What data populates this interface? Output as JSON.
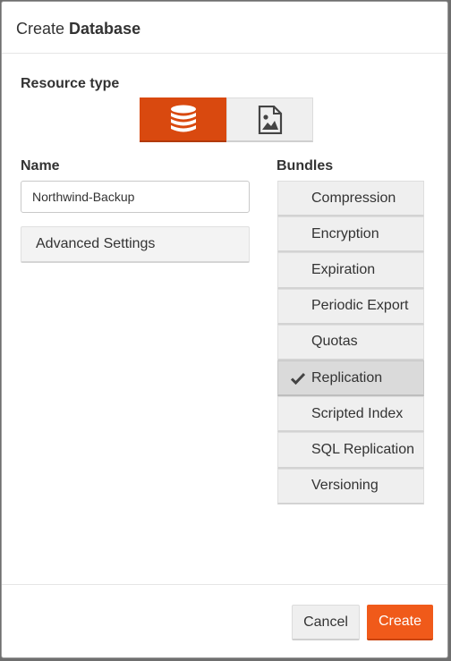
{
  "dialog": {
    "title_prefix": "Create",
    "title_bold": "Database"
  },
  "resource_type": {
    "label": "Resource type",
    "options": [
      {
        "icon": "database-icon",
        "selected": true
      },
      {
        "icon": "image-icon",
        "selected": false
      }
    ]
  },
  "name": {
    "label": "Name",
    "value": "Northwind-Backup"
  },
  "advanced_settings_label": "Advanced Settings",
  "bundles": {
    "label": "Bundles",
    "items": [
      {
        "label": "Compression",
        "selected": false
      },
      {
        "label": "Encryption",
        "selected": false
      },
      {
        "label": "Expiration",
        "selected": false
      },
      {
        "label": "Periodic Export",
        "selected": false
      },
      {
        "label": "Quotas",
        "selected": false
      },
      {
        "label": "Replication",
        "selected": true
      },
      {
        "label": "Scripted Index",
        "selected": false
      },
      {
        "label": "SQL Replication",
        "selected": false
      },
      {
        "label": "Versioning",
        "selected": false
      }
    ]
  },
  "footer": {
    "cancel_label": "Cancel",
    "create_label": "Create"
  },
  "colors": {
    "accent": "#f05a1a",
    "accent_active": "#d9490f"
  }
}
